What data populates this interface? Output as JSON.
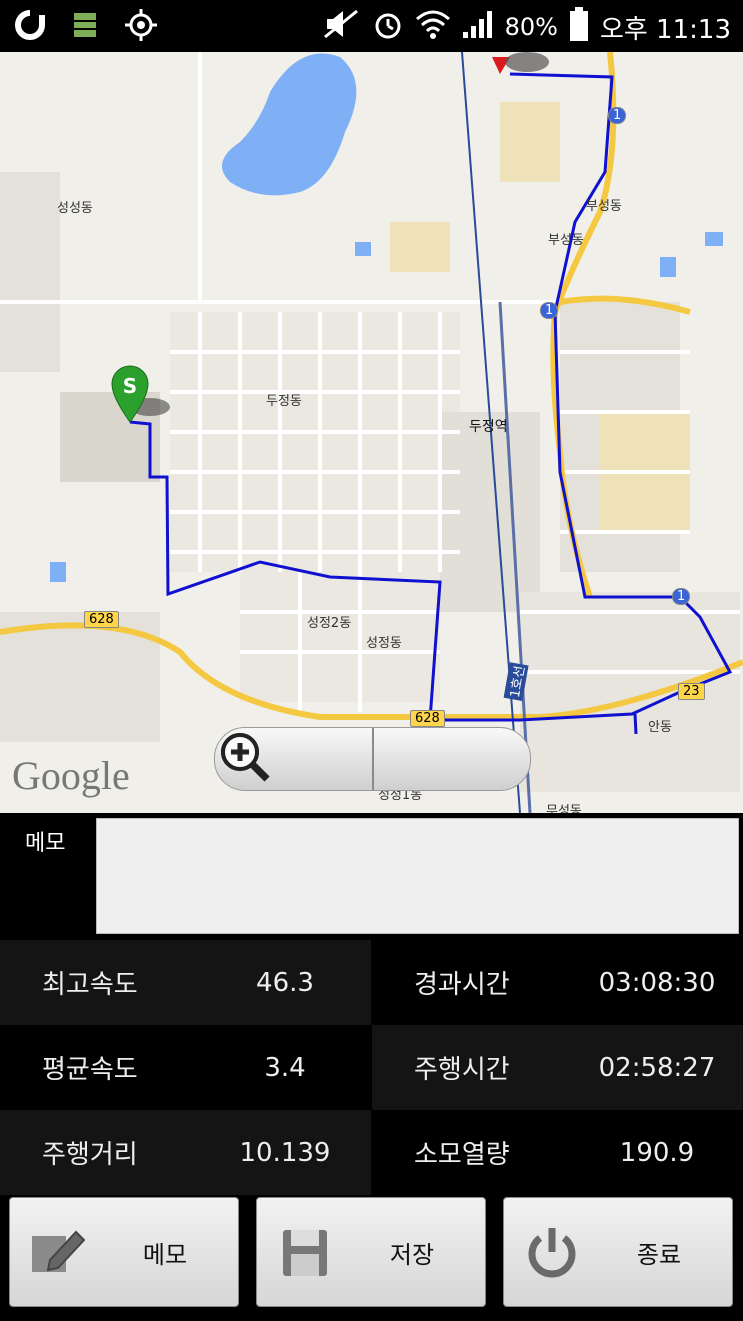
{
  "status_bar": {
    "battery_text": "80%",
    "time_text": "오후 11:13",
    "icons": [
      "o-icon",
      "storage-icon",
      "gps-icon",
      "mute-icon",
      "alarm-icon",
      "wifi-icon",
      "signal-icon",
      "battery-icon"
    ]
  },
  "map": {
    "labels": {
      "seongseong": "성성동",
      "dujeong": "두정동",
      "dujeong_station": "두정역",
      "buseong1": "부성동",
      "buseong2": "부성동",
      "seongjeong2": "성정2동",
      "seongjeong": "성정동",
      "museong": "무성동",
      "bottom_partial": "성정1동",
      "right_partial": "안동"
    },
    "shields": {
      "r628a": "628",
      "r628b": "628",
      "r1a": "1",
      "r1b": "1",
      "r1c": "1",
      "r23": "23"
    },
    "line_label": "1호선",
    "start_marker": "S",
    "google_logo": "Google",
    "colors": {
      "route": "#1010d0",
      "rail": "#2a4a9a",
      "water": "#7fb0f5",
      "road": "#ffffff",
      "major_road": "#f5c842"
    }
  },
  "memo": {
    "label": "메모",
    "value": ""
  },
  "stats": {
    "max_speed_label": "최고속도",
    "max_speed_value": "46.3",
    "elapsed_label": "경과시간",
    "elapsed_value": "03:08:30",
    "avg_speed_label": "평균속도",
    "avg_speed_value": "3.4",
    "moving_time_label": "주행시간",
    "moving_time_value": "02:58:27",
    "distance_label": "주행거리",
    "distance_value": "10.139",
    "calories_label": "소모열량",
    "calories_value": "190.9"
  },
  "buttons": {
    "memo_label": "메모",
    "save_label": "저장",
    "exit_label": "종료"
  }
}
